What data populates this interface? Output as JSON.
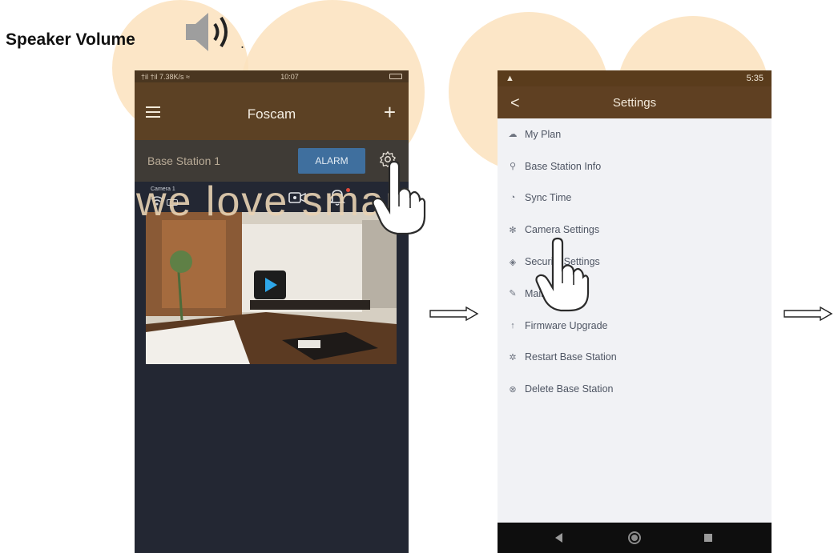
{
  "heading": {
    "label": "Speaker Volume",
    "trailing": "."
  },
  "watermark": {
    "text": "we love smart"
  },
  "phone1": {
    "status_left": "†il †il 7.38K/s ≈",
    "status_time": "10:07",
    "title": "Foscam",
    "add_glyph": "+",
    "base_station_label": "Base Station 1",
    "alarm_label": "ALARM",
    "camera_label": "Camera 1"
  },
  "phone2": {
    "status_time": "5:35",
    "back_glyph": "<",
    "title": "Settings",
    "menu": [
      {
        "label": "My Plan",
        "icon": "cloud-icon"
      },
      {
        "label": "Base Station Info",
        "icon": "pin-icon"
      },
      {
        "label": "Sync Time",
        "icon": "clock-icon"
      },
      {
        "label": "Camera Settings",
        "icon": "gear-icon"
      },
      {
        "label": "Security Settings",
        "icon": "shield-icon"
      },
      {
        "label": "Maintain",
        "icon": "wrench-icon"
      },
      {
        "label": "Firmware Upgrade",
        "icon": "arrow-up-icon"
      },
      {
        "label": "Restart Base Station",
        "icon": "restart-icon"
      },
      {
        "label": "Delete Base Station",
        "icon": "delete-icon"
      }
    ]
  },
  "colors": {
    "header_brown": "#5c4124",
    "alarm_blue": "#3f6f9e",
    "watermark_peach": "#fbe2bd"
  }
}
